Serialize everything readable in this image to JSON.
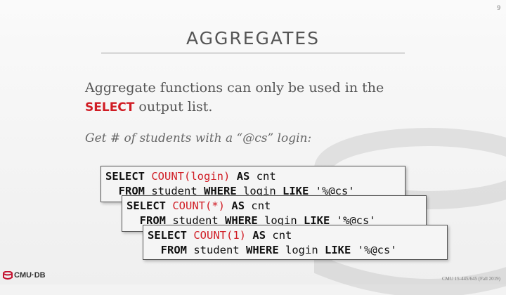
{
  "slide": {
    "page_number": "9",
    "title": "AGGREGATES",
    "body_line1": "Aggregate functions can only be used in the",
    "body_kw": "SELECT",
    "body_line2_rest": " output list.",
    "example": "Get # of students with a “@cs” login:",
    "footer": "CMU 15-445/645 (Fall 2019)",
    "logo_text": "CMU·DB"
  },
  "queries": [
    {
      "select": "SELECT",
      "func": "COUNT",
      "arg": "(login)",
      "as": "AS",
      "alias": " cnt",
      "from": "FROM",
      "table": " student ",
      "where": "WHERE",
      "col": " login ",
      "like": "LIKE",
      "pattern": " '%@cs'"
    },
    {
      "select": "SELECT",
      "func": "COUNT",
      "arg": "(*)",
      "as": "AS",
      "alias": " cnt",
      "from": "FROM",
      "table": " student ",
      "where": "WHERE",
      "col": " login ",
      "like": "LIKE",
      "pattern": " '%@cs'"
    },
    {
      "select": "SELECT",
      "func": "COUNT",
      "arg": "(1)",
      "as": "AS",
      "alias": " cnt",
      "from": "FROM",
      "table": " student ",
      "where": "WHERE",
      "col": " login ",
      "like": "LIKE",
      "pattern": " '%@cs'"
    }
  ]
}
